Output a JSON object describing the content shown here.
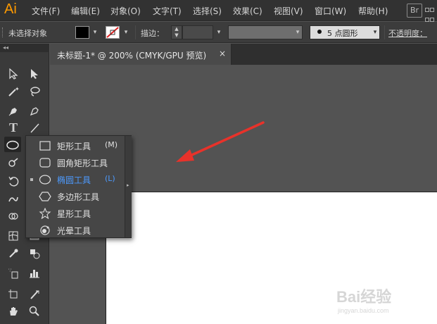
{
  "app": {
    "logo": "Ai"
  },
  "menubar": {
    "items": [
      "文件(F)",
      "编辑(E)",
      "对象(O)",
      "文字(T)",
      "选择(S)",
      "效果(C)",
      "视图(V)",
      "窗口(W)",
      "帮助(H)"
    ],
    "bridge_label": "Br"
  },
  "controlbar": {
    "selection_status": "未选择对象",
    "stroke_label": "描边：",
    "brush_value": "5 点圆形",
    "opacity_label": "不透明度："
  },
  "toolbar": {
    "collapse_label": "◂◂"
  },
  "document": {
    "tab_label": "未标题-1* @ 200% (CMYK/GPU 预览)",
    "close_label": "×"
  },
  "flyout": {
    "items": [
      {
        "label": "矩形工具",
        "key": "(M)",
        "icon": "rectangle-icon",
        "selected": false
      },
      {
        "label": "圆角矩形工具",
        "key": "",
        "icon": "rounded-rectangle-icon",
        "selected": false
      },
      {
        "label": "椭圆工具",
        "key": "(L)",
        "icon": "ellipse-icon",
        "selected": true
      },
      {
        "label": "多边形工具",
        "key": "",
        "icon": "polygon-icon",
        "selected": false
      },
      {
        "label": "星形工具",
        "key": "",
        "icon": "star-icon",
        "selected": false
      },
      {
        "label": "光晕工具",
        "key": "",
        "icon": "flare-icon",
        "selected": false
      }
    ],
    "tearoff_icon": "▸"
  },
  "annotation": {
    "arrow_color": "#e8322a"
  },
  "watermark": {
    "brand": "Bai经验",
    "url": "jingyan.baidu.com"
  }
}
